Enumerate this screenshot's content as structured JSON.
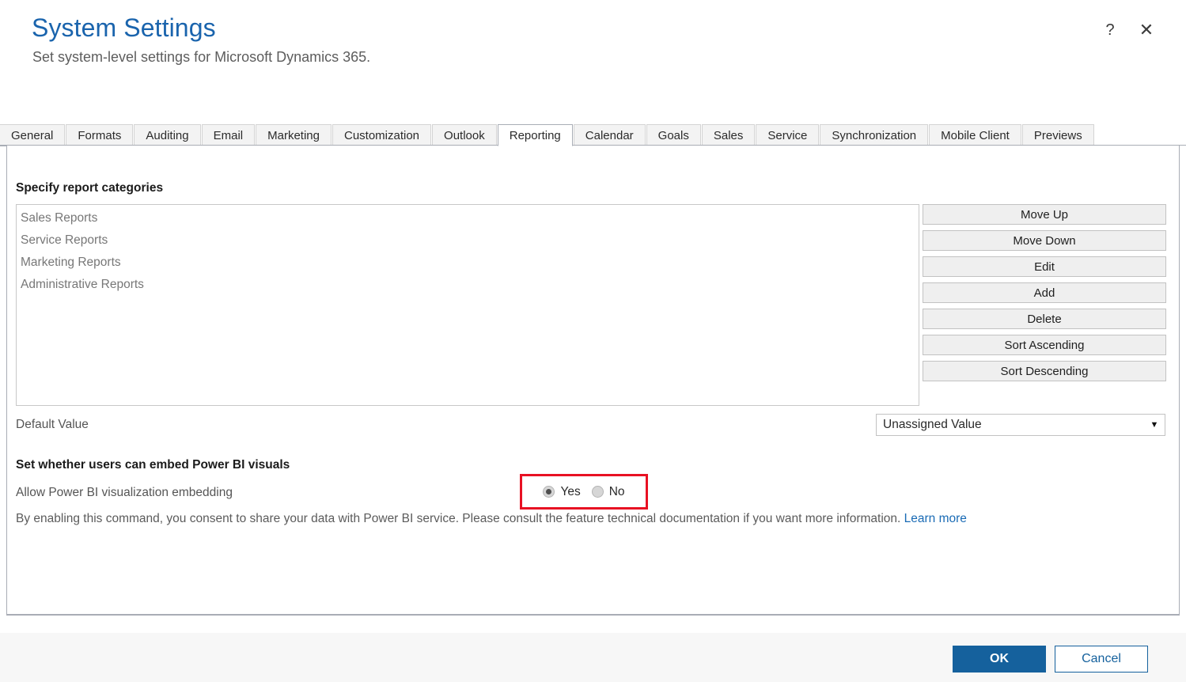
{
  "header": {
    "title": "System Settings",
    "subtitle": "Set system-level settings for Microsoft Dynamics 365.",
    "help_icon": "question-mark-icon",
    "help_glyph": "?",
    "close_icon": "close-icon",
    "close_glyph": "✕",
    "title_color": "#1a64ad"
  },
  "tabs": [
    {
      "label": "General",
      "active": false
    },
    {
      "label": "Formats",
      "active": false
    },
    {
      "label": "Auditing",
      "active": false
    },
    {
      "label": "Email",
      "active": false
    },
    {
      "label": "Marketing",
      "active": false
    },
    {
      "label": "Customization",
      "active": false
    },
    {
      "label": "Outlook",
      "active": false
    },
    {
      "label": "Reporting",
      "active": true
    },
    {
      "label": "Calendar",
      "active": false
    },
    {
      "label": "Goals",
      "active": false
    },
    {
      "label": "Sales",
      "active": false
    },
    {
      "label": "Service",
      "active": false
    },
    {
      "label": "Synchronization",
      "active": false
    },
    {
      "label": "Mobile Client",
      "active": false
    },
    {
      "label": "Previews",
      "active": false
    }
  ],
  "report_categories": {
    "heading": "Specify report categories",
    "items": [
      "Sales Reports",
      "Service Reports",
      "Marketing Reports",
      "Administrative Reports"
    ],
    "buttons": [
      "Move Up",
      "Move Down",
      "Edit",
      "Add",
      "Delete",
      "Sort Ascending",
      "Sort Descending"
    ],
    "default_value_label": "Default Value",
    "default_value_selected": "Unassigned Value",
    "dropdown_arrow_glyph": "▼"
  },
  "power_bi": {
    "heading": "Set whether users can embed Power BI visuals",
    "row_label": "Allow Power BI visualization embedding",
    "options": [
      {
        "label": "Yes",
        "checked": true
      },
      {
        "label": "No",
        "checked": false
      }
    ],
    "note_text": "By enabling this command, you consent to share your data with Power BI service. Please consult the feature technical documentation if you want more information. ",
    "note_link": "Learn more",
    "highlight_color": "#e81123"
  },
  "footer": {
    "ok_label": "OK",
    "cancel_label": "Cancel",
    "accent_color": "#15619d"
  }
}
